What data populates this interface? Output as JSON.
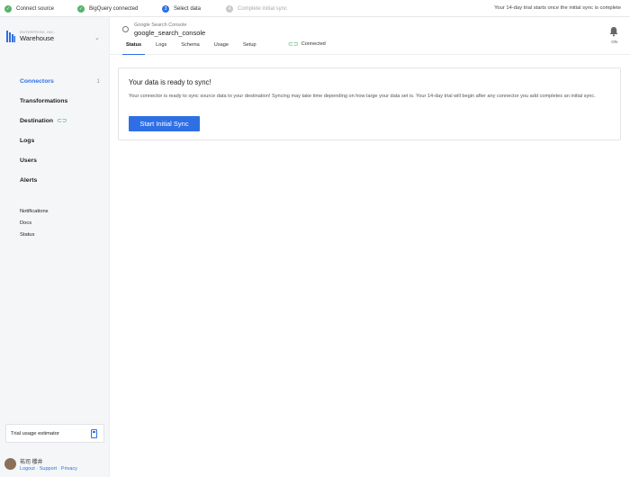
{
  "setup_steps": [
    {
      "label": "Connect source",
      "state": "done",
      "marker": "✓"
    },
    {
      "label": "BigQuery connected",
      "state": "done",
      "marker": "✓"
    },
    {
      "label": "Select data",
      "state": "current",
      "marker": "3"
    },
    {
      "label": "Complete initial sync",
      "state": "pending",
      "marker": "4"
    }
  ],
  "trial_message": "Your 14-day trial starts once the initial sync is complete",
  "brand": {
    "small_text": "ENTERPRISE, INC.",
    "name": "Warehouse"
  },
  "sidebar": {
    "items": [
      {
        "label": "Connectors",
        "count": "1"
      },
      {
        "label": "Transformations"
      },
      {
        "label": "Destination"
      },
      {
        "label": "Logs"
      },
      {
        "label": "Users"
      },
      {
        "label": "Alerts"
      }
    ],
    "secondary": [
      "Notifications",
      "Docs",
      "Status"
    ],
    "estimator_label": "Trial usage estimator",
    "user": {
      "name": "祐司 櫻井",
      "links": [
        "Logout",
        "Support",
        "Privacy"
      ]
    }
  },
  "connector": {
    "source": "Google Search Console",
    "name": "google_search_console",
    "tabs": [
      "Status",
      "Logs",
      "Schema",
      "Usage",
      "Setup"
    ],
    "status_label": "Connected",
    "bell_label": "ON"
  },
  "card": {
    "title": "Your data is ready to sync!",
    "body": "Your connector is ready to sync source data to your destination! Syncing may take time depending on how large your data set is. Your 14-day trial will begin after any connector you add completes an initial sync.",
    "button": "Start Initial Sync"
  },
  "colors": {
    "accent": "#2f6fe4",
    "success": "#56b36b"
  }
}
